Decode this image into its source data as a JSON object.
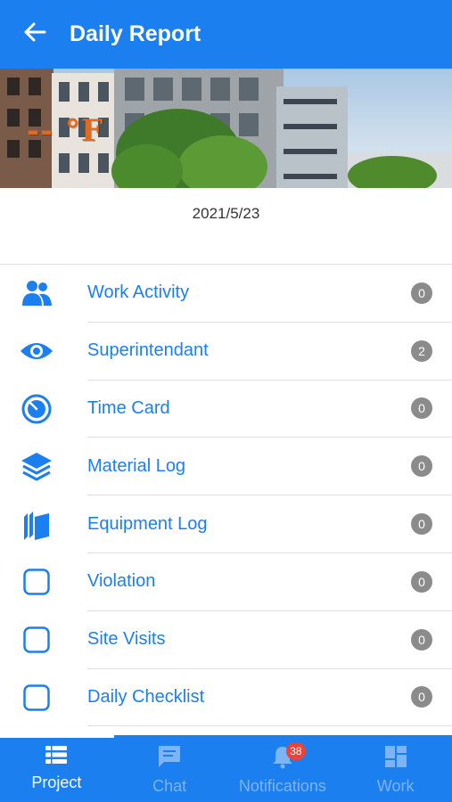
{
  "header": {
    "title": "Daily Report",
    "back_icon": "arrow-left-icon"
  },
  "weather": {
    "temperature": "-- °F"
  },
  "report": {
    "date": "2021/5/23"
  },
  "items": [
    {
      "label": "Work Activity",
      "count": "0",
      "icon": "people-icon"
    },
    {
      "label": "Superintendant",
      "count": "2",
      "icon": "eye-icon"
    },
    {
      "label": "Time Card",
      "count": "0",
      "icon": "timer-icon"
    },
    {
      "label": "Material Log",
      "count": "0",
      "icon": "layers-icon"
    },
    {
      "label": "Equipment Log",
      "count": "0",
      "icon": "boxes-icon"
    },
    {
      "label": "Violation",
      "count": "0",
      "icon": "checkbox-icon"
    },
    {
      "label": "Site Visits",
      "count": "0",
      "icon": "checkbox-icon"
    },
    {
      "label": "Daily Checklist",
      "count": "0",
      "icon": "checkbox-icon"
    }
  ],
  "tabs": [
    {
      "label": "Project",
      "icon": "list-icon",
      "active": true
    },
    {
      "label": "Chat",
      "icon": "chat-icon",
      "active": false
    },
    {
      "label": "Notifications",
      "icon": "bell-icon",
      "active": false,
      "badge": "38"
    },
    {
      "label": "Work",
      "icon": "grid-icon",
      "active": false
    }
  ],
  "colors": {
    "primary": "#1c7fef",
    "badge": "#e8443a",
    "count_badge": "#8b8b8b",
    "temperature": "#e06a1d"
  }
}
